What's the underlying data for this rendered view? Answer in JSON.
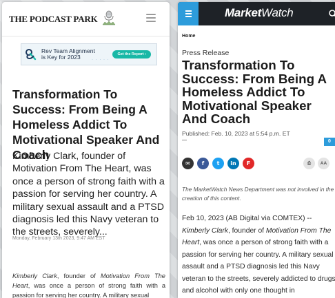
{
  "podcast_park": {
    "logo_text": "THE PODCAST PARK",
    "ad": {
      "line1": "Rev Team Alignment",
      "line2": "is Key for 2023",
      "button": "Get the Report ›"
    },
    "title": "Transformation To Success: From Being A Homeless Addict To Motivational Speaker And Coach",
    "excerpt": "Kimberly Clark, founder of Motivation From The Heart, was once a person of strong faith with a passion for serving her country. A military sexual assault and a PTSD diagnosis led this Navy veteran to the streets, severely...",
    "date": "Monday, February 13th 2023, 9:47 AM EST",
    "body": {
      "name": "Kimberly Clark",
      "sep1": ", founder of ",
      "org": "Motivation From The Heart",
      "rest": ", was once a person of strong faith with a passion for serving her country. A military sexual"
    }
  },
  "marketwatch": {
    "logo_bold": "Market",
    "logo_italic": "Watch",
    "breadcrumb": "Home",
    "kicker": "Press Release",
    "title": "Transformation To Success: From Being A Homeless Addict To Motivational Speaker And Coach",
    "published": "Published: Feb. 10, 2023 at 5:54 p.m. ET",
    "comment_count": "0",
    "share_buttons": [
      {
        "name": "email",
        "glyph": "✉",
        "color": "#333333"
      },
      {
        "name": "facebook",
        "glyph": "f",
        "color": "#3b5998"
      },
      {
        "name": "twitter",
        "glyph": "t",
        "color": "#1da1f2"
      },
      {
        "name": "linkedin",
        "glyph": "in",
        "color": "#0077b5"
      },
      {
        "name": "flipboard",
        "glyph": "F",
        "color": "#e12828"
      }
    ],
    "tools": [
      {
        "name": "print",
        "glyph": "⎙"
      },
      {
        "name": "text-size",
        "glyph": "AA"
      }
    ],
    "disclaimer": "The MarketWatch News Department was not involved in the creation of this content.",
    "body": {
      "lead": "Feb 10, 2023 (AB Digital via COMTEX) -- ",
      "name": "Kimberly Clark",
      "sep1": ", founder of ",
      "org": "Motivation From The Heart",
      "rest": ", was once a person of strong faith with a passion for serving her country. A military sexual assault and a PTSD diagnosis led this Navy veteran to the streets, severely addicted to drugs and alcohol with only one thought in"
    }
  }
}
